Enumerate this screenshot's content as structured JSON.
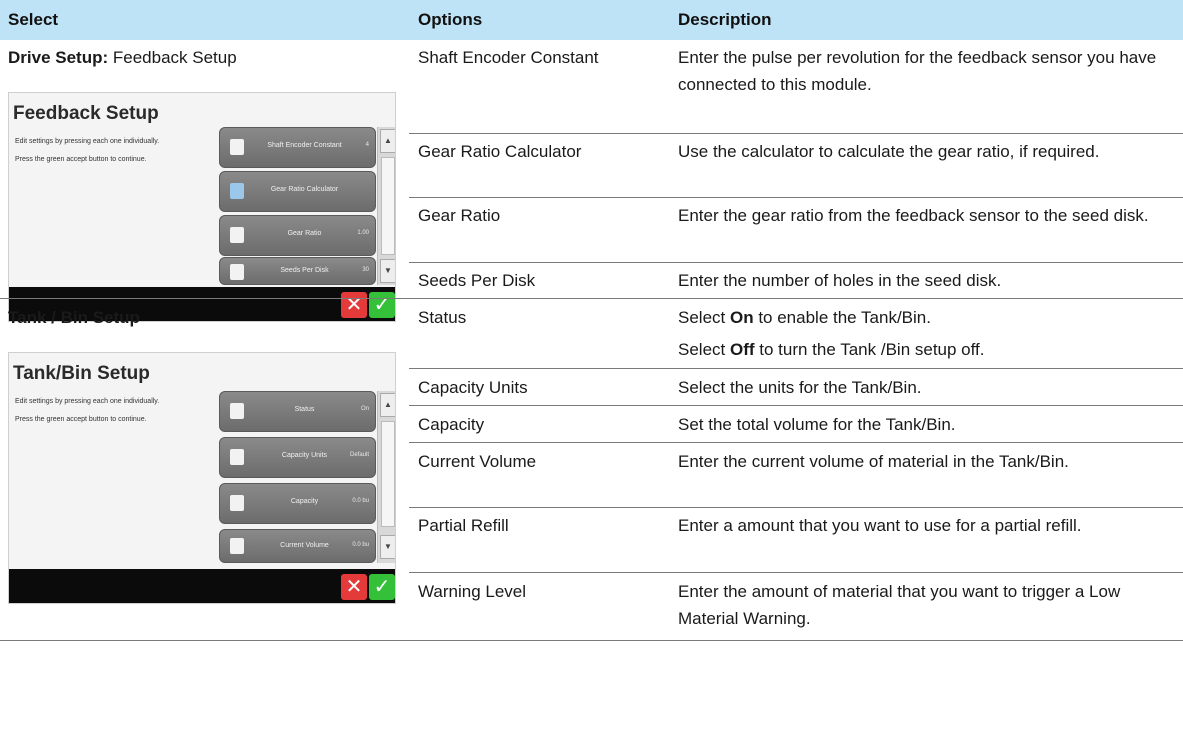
{
  "header": {
    "col1": "Select",
    "col2": "Options",
    "col3": "Description"
  },
  "feedback": {
    "title_bold": "Drive Setup:",
    "title_rest": " Feedback Setup",
    "screen": {
      "title": "Feedback Setup",
      "text1": "Edit settings by pressing each one individually.",
      "text2": "Press the green accept button to continue.",
      "buttons": [
        {
          "label": "Shaft Encoder Constant",
          "value": "4"
        },
        {
          "label": "Gear Ratio Calculator",
          "value": ""
        },
        {
          "label": "Gear Ratio",
          "value": "1.00"
        },
        {
          "label": "Seeds Per Disk",
          "value": "30"
        }
      ]
    },
    "rows": [
      {
        "option": "Shaft Encoder Constant",
        "description": "Enter the pulse per revolution for the feedback sensor you have connected to this module."
      },
      {
        "option": "Gear Ratio Calculator",
        "description": "Use the calculator to calculate the gear ratio, if required."
      },
      {
        "option": "Gear Ratio",
        "description": "Enter the gear ratio from the feedback sensor to the seed disk."
      },
      {
        "option": "Seeds Per Disk",
        "description": "Enter the number of holes in the seed disk."
      }
    ]
  },
  "tank": {
    "title": "Tank / Bin Setup",
    "screen": {
      "title": "Tank/Bin Setup",
      "text1": "Edit settings by pressing each one individually.",
      "text2": "Press the green accept button to continue.",
      "buttons": [
        {
          "label": "Status",
          "value": "On"
        },
        {
          "label": "Capacity Units",
          "value": "Default"
        },
        {
          "label": "Capacity",
          "value": "0.0 bu"
        },
        {
          "label": "Current Volume",
          "value": "0.0 bu"
        }
      ]
    },
    "status": {
      "option": "Status",
      "line1_pre": "Select ",
      "line1_bold": "On",
      "line1_post": " to enable the Tank/Bin.",
      "line2_pre": "Select ",
      "line2_bold": "Off",
      "line2_post": " to turn the Tank /Bin setup off."
    },
    "rows": [
      {
        "option": "Capacity Units",
        "description": "Select the units for the Tank/Bin."
      },
      {
        "option": "Capacity",
        "description": "Set the total volume for the Tank/Bin."
      },
      {
        "option": "Current Volume",
        "description": "Enter the current volume of material in the Tank/Bin."
      },
      {
        "option": "Partial Refill",
        "description": "Enter a amount that you want to use for a partial refill."
      },
      {
        "option": "Warning Level",
        "description": "Enter the amount of material that you want to trigger a Low Material Warning."
      }
    ]
  },
  "colors": {
    "header_bg": "#bfe3f6",
    "cancel": "#e53a3a",
    "accept": "#35c03a"
  }
}
